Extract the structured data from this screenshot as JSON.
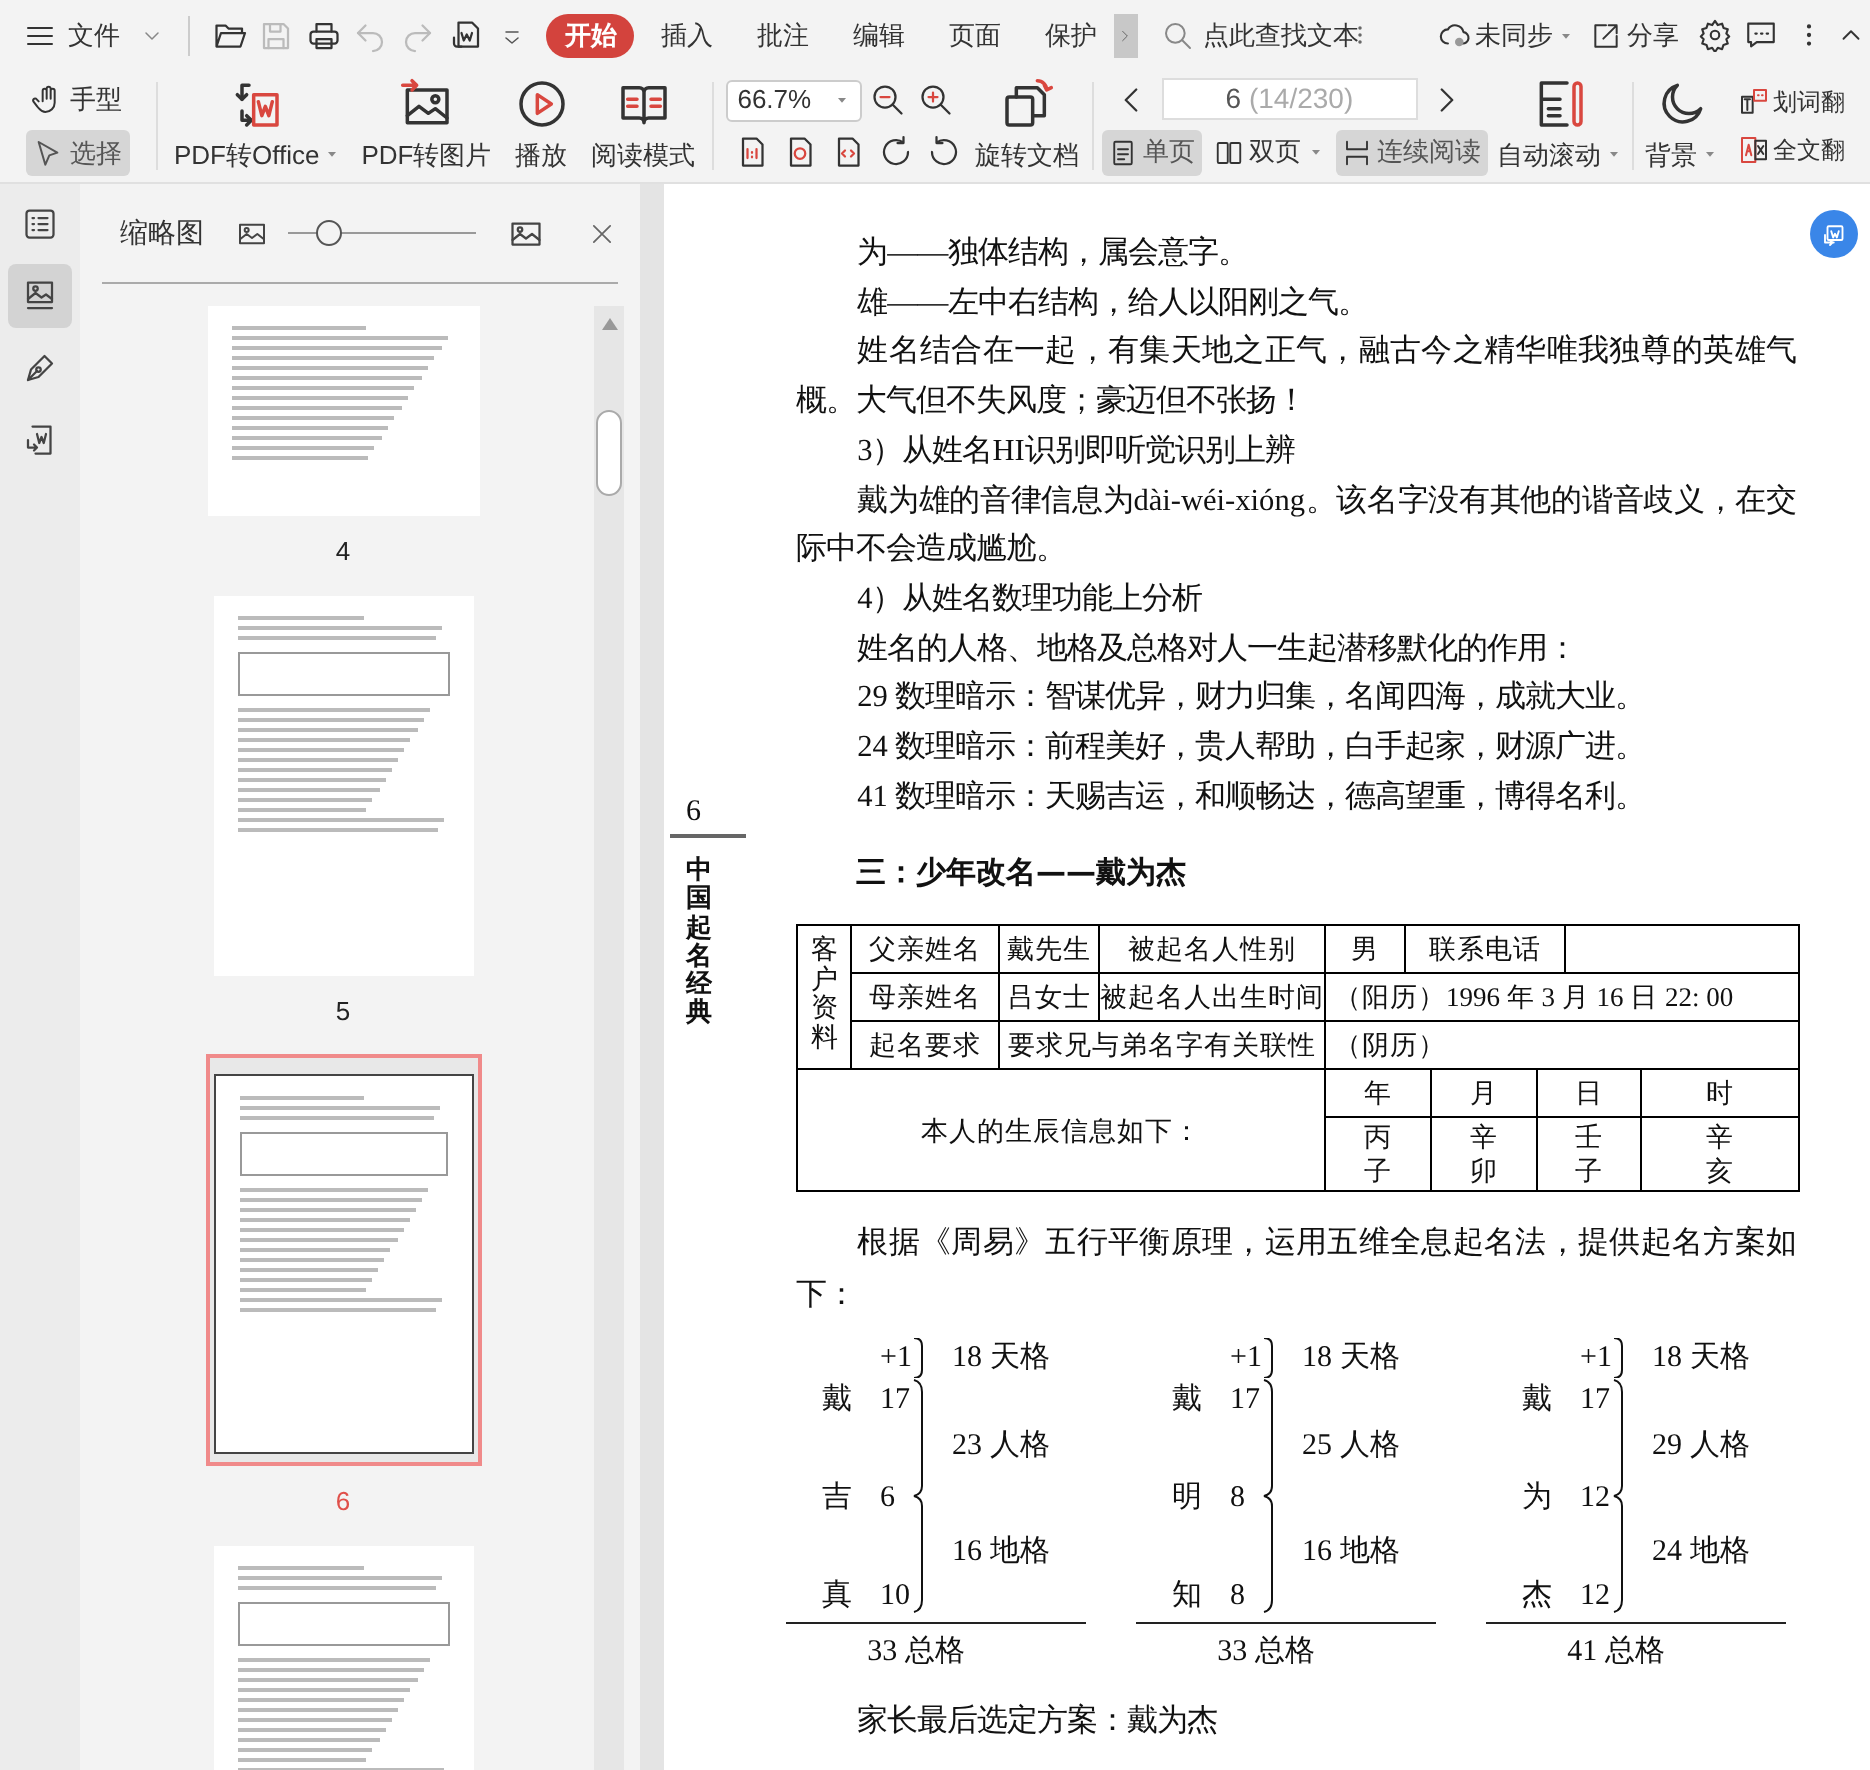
{
  "menubar": {
    "file_menu": "文件",
    "quick_access": [
      {
        "kind": "open",
        "disabled": false
      },
      {
        "kind": "save",
        "disabled": true
      },
      {
        "kind": "print",
        "disabled": false
      },
      {
        "kind": "undo",
        "disabled": true
      },
      {
        "kind": "redo",
        "disabled": true
      },
      {
        "kind": "pdf_word",
        "disabled": false
      }
    ],
    "tabs": [
      {
        "label": "开始",
        "selected": true
      },
      {
        "label": "插入",
        "selected": false
      },
      {
        "label": "批注",
        "selected": false
      },
      {
        "label": "编辑",
        "selected": false
      },
      {
        "label": "页面",
        "selected": false
      },
      {
        "label": "保护",
        "selected": false
      }
    ],
    "search": {
      "placeholder": "点此查找文本"
    },
    "sync": "未同步",
    "share": "分享"
  },
  "toolbar": {
    "tools": [
      {
        "kind": "hand",
        "label": "手型",
        "selected": false
      },
      {
        "kind": "select",
        "label": "选择",
        "selected": true
      }
    ],
    "actions": [
      {
        "kind": "pdf_office",
        "label": "PDF转Office",
        "dropdown": true
      },
      {
        "kind": "pdf_image",
        "label": "PDF转图片",
        "dropdown": false
      },
      {
        "kind": "play",
        "label": "播放",
        "dropdown": false
      },
      {
        "kind": "reading",
        "label": "阅读模式",
        "dropdown": false
      }
    ],
    "zoom": "66.7%",
    "rotate": "旋转文档",
    "page_input": {
      "value": "6",
      "total": "(14/230)"
    },
    "views": [
      {
        "kind": "single",
        "label": "单页",
        "selected": true,
        "dropdown": false
      },
      {
        "kind": "double",
        "label": "双页",
        "selected": false,
        "dropdown": true
      },
      {
        "kind": "continuous",
        "label": "连续阅读",
        "selected": true,
        "dropdown": false
      }
    ],
    "auto_scroll": "自动滚动",
    "background": "背景",
    "translate_words": "划词翻",
    "translate_full": "全文翻"
  },
  "sidebar": {
    "rail": [
      {
        "kind": "outline",
        "selected": false
      },
      {
        "kind": "thumbnails",
        "selected": true
      },
      {
        "kind": "annotate",
        "selected": false
      },
      {
        "kind": "convert",
        "selected": false
      }
    ]
  },
  "thumbnail_panel": {
    "title": "缩略图",
    "size_slider": {
      "level": 0.21
    },
    "pages": [
      {
        "label": "4",
        "selected": false
      },
      {
        "label": "5",
        "selected": false
      },
      {
        "label": "6",
        "selected": true
      },
      {
        "selected": false
      }
    ]
  },
  "document": {
    "page_number": "6",
    "running_head": "中国起名经典",
    "paragraphs": [
      "为——独体结构，属会意字。",
      "雄——左中右结构，给人以阳刚之气。",
      "姓名结合在一起，有集天地之正气，融古今之精华唯我独尊的英雄气概。大气但不失风度；豪迈但不张扬！",
      "3）从姓名HI识别即听觉识别上辨",
      "戴为雄的音律信息为dài-wéi-xióng。该名字没有其他的谐音歧义，在交际中不会造成尴尬。",
      "4）从姓名数理功能上分析",
      "姓名的人格、地格及总格对人一生起潜移默化的作用：",
      "29 数理暗示：智谋优异，财力归集，名闻四海，成就大业。",
      "24 数理暗示：前程美好，贵人帮助，白手起家，财源广进。",
      "41 数理暗示：天赐吉运，和顺畅达，德高望重，博得名利。"
    ],
    "heading": "三：少年改名——戴为杰",
    "client_table": {
      "rows": [
        [
          {
            "text": "客户资料",
            "rowspan": 3,
            "vertical": true
          },
          {
            "text": "父亲姓名"
          },
          {
            "text": "戴先生"
          },
          {
            "text": "被起名人性别"
          },
          {
            "text": "男"
          },
          {
            "text": "联系电话",
            "colspan": 3
          }
        ],
        [
          {
            "text": "母亲姓名"
          },
          {
            "text": "吕女士"
          },
          {
            "text": "被起名人出生时间"
          },
          {
            "text": "（阳历）1996 年 3 月 16 日 22: 00",
            "colspan": 6
          }
        ],
        [
          {
            "text": "起名要求"
          },
          {
            "text": "要求兄与弟名字有关联性",
            "colspan": 2
          },
          {
            "text": "（阴历）",
            "colspan": 6
          }
        ],
        [
          {
            "text": "本人的生辰信息如下：",
            "colspan": 4,
            "rowspan": 2
          },
          {
            "text": "年",
            "colspan": 2
          },
          {
            "text": "月"
          },
          {
            "text": "日",
            "colspan": 2
          },
          {
            "text": "时"
          }
        ],
        [
          {
            "lines": [
              "丙",
              "子"
            ],
            "colspan": 2
          },
          {
            "lines": [
              "辛",
              "卯"
            ]
          },
          {
            "lines": [
              "壬",
              "子"
            ],
            "colspan": 2
          },
          {
            "lines": [
              "辛",
              "亥"
            ]
          }
        ]
      ]
    },
    "intro": "根据《周易》五行平衡原理，运用五维全息起名法，提供起名方案如下：",
    "schemes": [
      {
        "top": "+1",
        "heaven": "18 天格",
        "chars": [
          {
            "char": "戴",
            "stroke": "17"
          },
          {
            "char": "吉",
            "stroke": "6"
          },
          {
            "char": "真",
            "stroke": "10"
          }
        ],
        "person": "23 人格",
        "earth": "16 地格",
        "total": "33 总格"
      },
      {
        "top": "+1",
        "heaven": "18 天格",
        "chars": [
          {
            "char": "戴",
            "stroke": "17"
          },
          {
            "char": "明",
            "stroke": "8"
          },
          {
            "char": "知",
            "stroke": "8"
          }
        ],
        "person": "25 人格",
        "earth": "16 地格",
        "total": "33 总格"
      },
      {
        "top": "+1",
        "heaven": "18 天格",
        "chars": [
          {
            "char": "戴",
            "stroke": "17"
          },
          {
            "char": "为",
            "stroke": "12"
          },
          {
            "char": "杰",
            "stroke": "12"
          }
        ],
        "person": "29 人格",
        "earth": "24 地格",
        "total": "41 总格"
      }
    ],
    "conclusion": "家长最后选定方案：戴为杰"
  }
}
